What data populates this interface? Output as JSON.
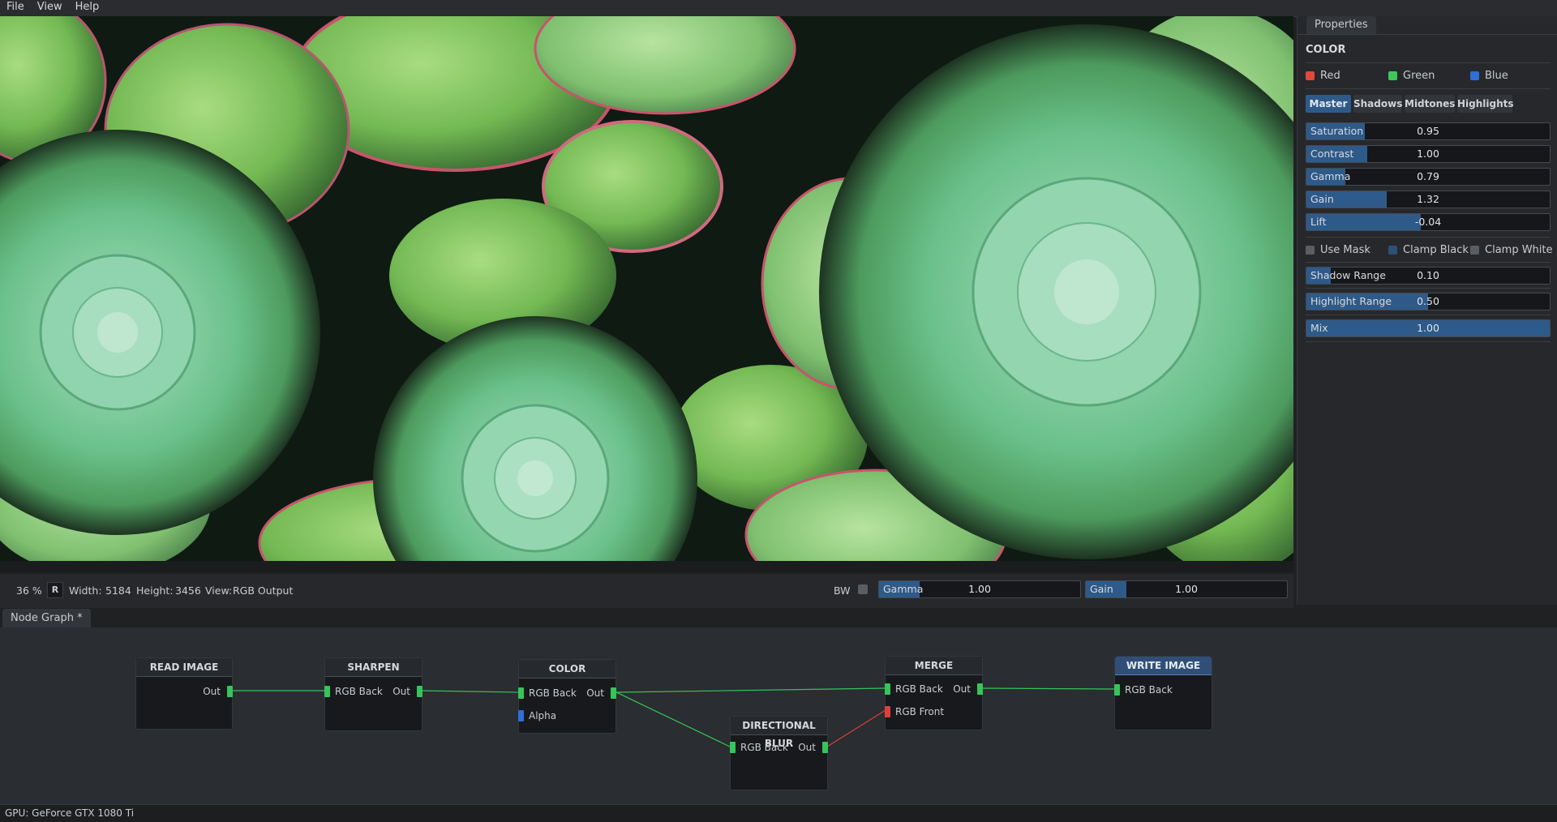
{
  "menu": {
    "items": [
      "File",
      "View",
      "Help"
    ]
  },
  "viewer": {
    "zoom": "36 %",
    "channel": "R",
    "width_label": "Width:",
    "width_value": "5184",
    "height_label": "Height:",
    "height_value": "3456",
    "view_label": "View:",
    "view_value": "RGB Output",
    "bw_label": "BW",
    "gamma": {
      "label": "Gamma",
      "value": "1.00",
      "fill": 0.2
    },
    "gain": {
      "label": "Gain",
      "value": "1.00",
      "fill": 0.2
    }
  },
  "properties": {
    "tab": "Properties",
    "section": "COLOR",
    "channels": [
      {
        "label": "Red",
        "color": "#e0483e"
      },
      {
        "label": "Green",
        "color": "#3fc65a"
      },
      {
        "label": "Blue",
        "color": "#2f6fd6"
      }
    ],
    "subtabs": [
      "Master",
      "Shadows",
      "Midtones",
      "Highlights"
    ],
    "active_subtab": "Master",
    "sliders": [
      {
        "label": "Saturation",
        "value": "0.95",
        "fill": 0.24
      },
      {
        "label": "Contrast",
        "value": "1.00",
        "fill": 0.25
      },
      {
        "label": "Gamma",
        "value": "0.79",
        "fill": 0.16
      },
      {
        "label": "Gain",
        "value": "1.32",
        "fill": 0.33
      },
      {
        "label": "Lift",
        "value": "-0.04",
        "fill": 0.47
      }
    ],
    "toggles": [
      {
        "label": "Use Mask",
        "color": "#5a5d62"
      },
      {
        "label": "Clamp Black",
        "color": "#2e4f78"
      },
      {
        "label": "Clamp White",
        "color": "#5a5d62"
      }
    ],
    "range_sliders": [
      {
        "label": "Shadow Range",
        "value": "0.10",
        "fill": 0.1
      },
      {
        "label": "Highlight Range",
        "value": "0.50",
        "fill": 0.5
      },
      {
        "label": "Mix",
        "value": "1.00",
        "fill": 1.0
      }
    ]
  },
  "graph": {
    "tab": "Node Graph *",
    "nodes": {
      "read": {
        "title": "READ IMAGE",
        "out": "Out"
      },
      "sharpen": {
        "title": "SHARPEN",
        "in": "RGB Back",
        "out": "Out"
      },
      "color": {
        "title": "COLOR",
        "in": "RGB Back",
        "alpha": "Alpha",
        "out": "Out"
      },
      "blur": {
        "title": "DIRECTIONAL BLUR",
        "in": "RGB Back",
        "out": "Out"
      },
      "merge": {
        "title": "MERGE",
        "in_back": "RGB Back",
        "in_front": "RGB Front",
        "out": "Out"
      },
      "write": {
        "title": "WRITE IMAGE",
        "in": "RGB Back"
      }
    }
  },
  "status": {
    "gpu": "GPU: GeForce GTX 1080 Ti"
  }
}
